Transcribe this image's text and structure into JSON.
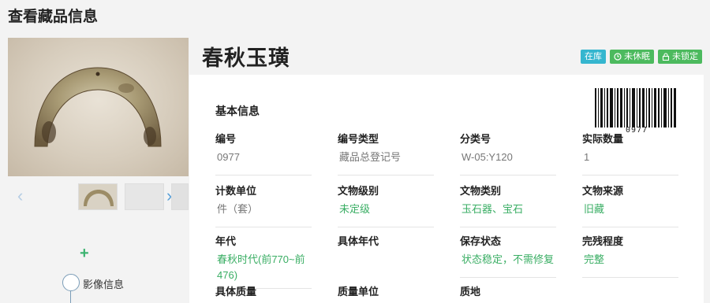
{
  "page_title": "查看藏品信息",
  "object_title": "春秋玉璜",
  "badges": {
    "status": "在库",
    "sleep": "未休眠",
    "lock": "未锁定"
  },
  "barcode_text": "0977",
  "gallery": {
    "prev_icon": "chevron-left-icon",
    "next_icon": "chevron-right-icon"
  },
  "timeline": {
    "add_icon": "plus-icon",
    "label": "影像信息"
  },
  "section_title": "基本信息",
  "fields": [
    {
      "label": "编号",
      "value": "0977"
    },
    {
      "label": "编号类型",
      "value": "藏品总登记号"
    },
    {
      "label": "分类号",
      "value": "W-05:Y120"
    },
    {
      "label": "实际数量",
      "value": "1"
    },
    {
      "label": "计数单位",
      "value": "件（套）"
    },
    {
      "label": "文物级别",
      "value": "未定级"
    },
    {
      "label": "文物类别",
      "value": "玉石器、宝石"
    },
    {
      "label": "文物来源",
      "value": "旧藏"
    },
    {
      "label": "年代",
      "value": "春秋时代(前770~前476)"
    },
    {
      "label": "具体年代",
      "value": ""
    },
    {
      "label": "保存状态",
      "value": "状态稳定，不需修复"
    },
    {
      "label": "完残程度",
      "value": "完整"
    },
    {
      "label": "具体质量",
      "value": ""
    },
    {
      "label": "质量单位",
      "value": ""
    },
    {
      "label": "质地",
      "value": ""
    }
  ],
  "colors": {
    "link_green": "#3aae64",
    "badge_blue": "#35b6cf",
    "badge_green": "#4cba5e"
  }
}
